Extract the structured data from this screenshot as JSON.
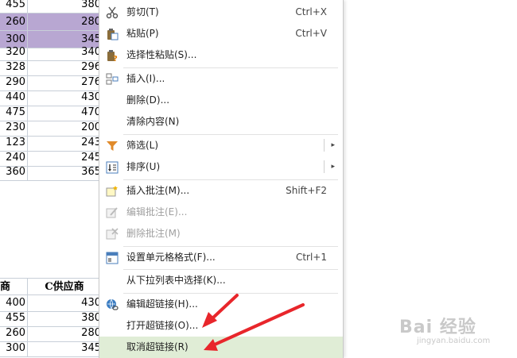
{
  "sheet_top": {
    "rows": [
      {
        "a": "455",
        "b": "380",
        "selected": false
      },
      {
        "a": "260",
        "b": "280",
        "selected": true
      },
      {
        "a": "300",
        "b": "345",
        "selected": true
      },
      {
        "a": "320",
        "b": "340",
        "selected": false
      },
      {
        "a": "328",
        "b": "296",
        "selected": false
      },
      {
        "a": "290",
        "b": "276",
        "selected": false
      },
      {
        "a": "440",
        "b": "430",
        "selected": false
      },
      {
        "a": "475",
        "b": "470",
        "selected": false
      },
      {
        "a": "230",
        "b": "200",
        "selected": false
      },
      {
        "a": "123",
        "b": "243",
        "selected": false
      },
      {
        "a": "240",
        "b": "245",
        "selected": false
      },
      {
        "a": "360",
        "b": "365",
        "selected": false
      }
    ]
  },
  "sheet_bottom": {
    "headers": [
      "商",
      "C供应商"
    ],
    "rows": [
      {
        "a": "400",
        "b": "430"
      },
      {
        "a": "455",
        "b": "380"
      },
      {
        "a": "260",
        "b": "280"
      },
      {
        "a": "300",
        "b": "345"
      }
    ]
  },
  "menu": {
    "items": [
      {
        "label": "剪切(T)",
        "shortcut": "Ctrl+X",
        "icon": "scissors-icon"
      },
      {
        "label": "粘贴(P)",
        "shortcut": "Ctrl+V",
        "icon": "paste-icon"
      },
      {
        "label": "选择性粘贴(S)...",
        "shortcut": "",
        "icon": "paste-special-icon"
      },
      {
        "label": "插入(I)...",
        "shortcut": "",
        "icon": "insert-cells-icon"
      },
      {
        "label": "删除(D)...",
        "shortcut": "",
        "icon": ""
      },
      {
        "label": "清除内容(N)",
        "shortcut": "",
        "icon": ""
      },
      {
        "label": "筛选(L)",
        "shortcut": "",
        "icon": "filter-icon",
        "submenu": true
      },
      {
        "label": "排序(U)",
        "shortcut": "",
        "icon": "sort-icon",
        "submenu": true
      },
      {
        "label": "插入批注(M)...",
        "shortcut": "Shift+F2",
        "icon": "insert-comment-icon"
      },
      {
        "label": "编辑批注(E)...",
        "shortcut": "",
        "icon": "edit-comment-icon",
        "disabled": true
      },
      {
        "label": "删除批注(M)",
        "shortcut": "",
        "icon": "delete-comment-icon",
        "disabled": true
      },
      {
        "label": "设置单元格格式(F)...",
        "shortcut": "Ctrl+1",
        "icon": "format-cells-icon"
      },
      {
        "label": "从下拉列表中选择(K)...",
        "shortcut": "",
        "icon": ""
      },
      {
        "label": "编辑超链接(H)...",
        "shortcut": "",
        "icon": "hyperlink-icon"
      },
      {
        "label": "打开超链接(O)...",
        "shortcut": "",
        "icon": ""
      },
      {
        "label": "取消超链接(R)",
        "shortcut": "",
        "icon": "",
        "highlighted": true
      }
    ]
  },
  "watermark": {
    "brand": "Bai 经验",
    "url": "jingyan.baidu.com"
  },
  "colors": {
    "selection": "#b8a7d2",
    "hover": "#e0edd6",
    "arrow": "#e8262b"
  }
}
